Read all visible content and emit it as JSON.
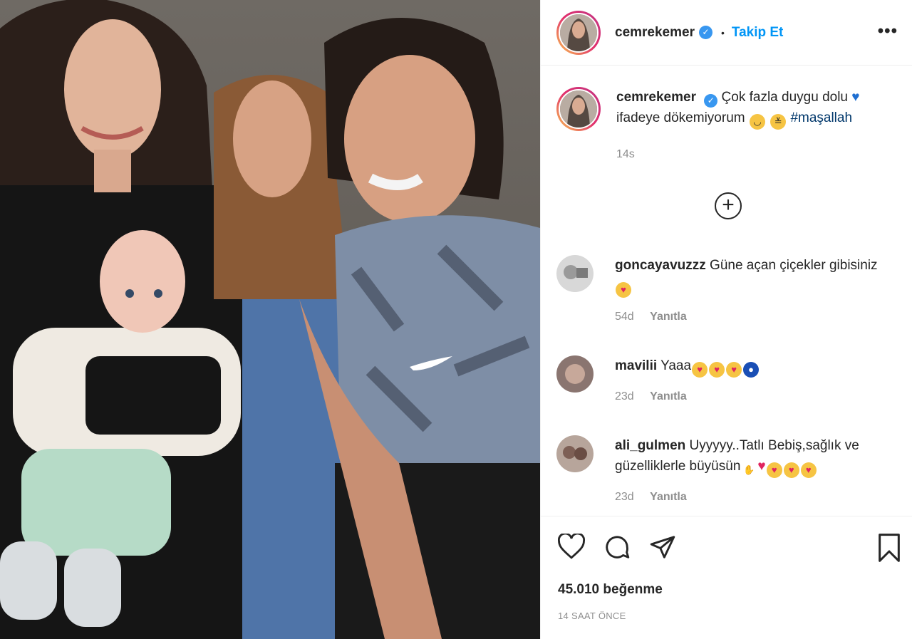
{
  "post": {
    "username": "cemrekemer",
    "verified": true,
    "separator": "•",
    "follow_label": "Takip Et",
    "more_label": "•••"
  },
  "caption": {
    "username": "cemrekemer",
    "text": "Çok fazla duygu dolu",
    "text2": "ifadeye dökemiyorum",
    "hashtag": "#maşallah",
    "time": "14s"
  },
  "load_more_label": "+",
  "comments": [
    {
      "username": "goncayavuzzz",
      "text": "Güne açan çiçekler gibisiniz",
      "time": "54d",
      "reply": "Yanıtla"
    },
    {
      "username": "mavilii",
      "text": "Yaaa",
      "time": "23d",
      "reply": "Yanıtla"
    },
    {
      "username": "ali_gulmen",
      "text": "Uyyyyy..Tatlı Bebiş,sağlık ve güzelliklerle büyüsün",
      "time": "23d",
      "reply": "Yanıtla"
    }
  ],
  "likes": "45.010 beğenme",
  "posted_ago": "14 SAAT ÖNCE",
  "colors": {
    "link_blue": "#0095f6",
    "hashtag": "#00376b",
    "muted": "#8e8e8e",
    "heart_red": "#ed4956",
    "blue_heart": "#1f6fd1"
  },
  "icons": [
    "verified-icon",
    "more-icon",
    "plus-circle-icon",
    "heart-icon",
    "comment-icon",
    "share-icon",
    "bookmark-icon"
  ]
}
